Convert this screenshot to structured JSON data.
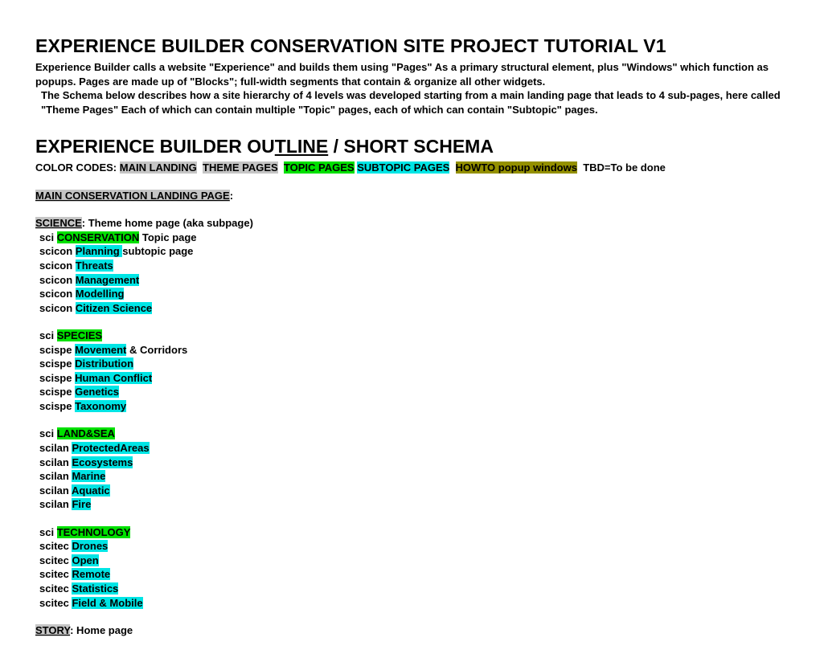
{
  "title": "EXPERIENCE BUILDER CONSERVATION SITE PROJECT TUTORIAL V1",
  "intro": {
    "line1_a": "Experience Builder calls a website \"Experience\" and builds them using \"Pages\" As a primary structural element, plus \"Windows\" which function as popups.   Pages are made up of \"Blocks\"; full-width segments that contain & organize all other widgets.",
    "line2": "The Schema below describes how a site hierarchy of 4 levels was developed starting from a  main landing page that leads to 4 sub-pages, here called \"Theme Pages\" Each of which can contain multiple \"Topic\" pages, each of which can contain \"Subtopic\" pages."
  },
  "subtitle": {
    "pre": "EXPERIENCE BUILDER OU",
    "tline": "TLINE",
    "post": " / SHORT SCHEMA"
  },
  "legend": {
    "label": "COLOR CODES:  ",
    "main": "MAIN LANDING",
    "theme": "THEME PAGES",
    "topic": "TOPIC PAGES",
    "subtopic": "SUBTOPIC PAGES",
    "howto": "HOWTO popup windows",
    "tbd": "TBD=To be done"
  },
  "tree": {
    "main_landing": "MAIN CONSERVATION LANDING PAGE",
    "science": {
      "label": "SCIENCE",
      "suffix": ": Theme home page (aka subpage)",
      "groups": [
        {
          "prefix": "sci ",
          "topic": "CONSERVATION",
          "topic_suffix": " Topic page",
          "child_prefix": "scicon ",
          "children": [
            {
              "name": "Planning ",
              "suffix": " subtopic page"
            },
            {
              "name": "Threats"
            },
            {
              "name": "Management"
            },
            {
              "name": "Modelling"
            },
            {
              "name": "Citizen Science"
            }
          ]
        },
        {
          "prefix": "sci ",
          "topic": "SPECIES",
          "child_prefix": "scispe ",
          "children": [
            {
              "name": "Movement",
              "suffix": " & Corridors"
            },
            {
              "name": "Distribution"
            },
            {
              "name": "Human Conflict"
            },
            {
              "name": "Genetics"
            },
            {
              "name": "Taxonomy"
            }
          ]
        },
        {
          "prefix": "sci ",
          "topic": "LAND&SEA",
          "child_prefix": "scilan ",
          "children": [
            {
              "name": "ProtectedAreas"
            },
            {
              "name": "Ecosystems"
            },
            {
              "name": "Marine"
            },
            {
              "name": "Aquatic"
            },
            {
              "name": "Fire"
            }
          ]
        },
        {
          "prefix": "sci ",
          "topic": "TECHNOLOGY",
          "child_prefix": "scitec ",
          "children": [
            {
              "name": "Drones"
            },
            {
              "name": "Open"
            },
            {
              "name": "Remote"
            },
            {
              "name": "Statistics"
            },
            {
              "name": "Field & Mobile"
            }
          ]
        }
      ]
    },
    "story": {
      "label": "STORY",
      "suffix": ": Home page"
    }
  }
}
